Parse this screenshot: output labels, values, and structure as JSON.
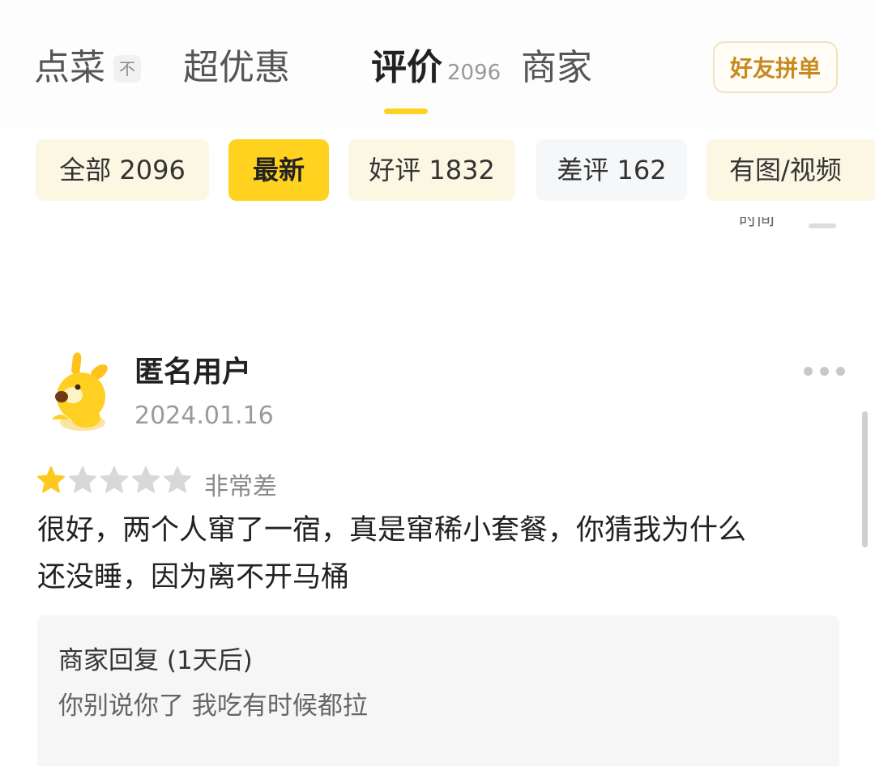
{
  "tabs": {
    "menu": {
      "label": "点菜",
      "badge": "不"
    },
    "deals": {
      "label": "超优惠"
    },
    "reviews": {
      "label": "评价",
      "count": "2096"
    },
    "merchant": {
      "label": "商家"
    },
    "active": "reviews"
  },
  "group_order_button": "好友拼单",
  "filters": [
    {
      "label": "全部 2096",
      "selected": false
    },
    {
      "label": "最新",
      "selected": true
    },
    {
      "label": "好评 1832",
      "selected": false
    },
    {
      "label": "差评 162",
      "selected": false
    },
    {
      "label": "有图/视频",
      "selected": false
    }
  ],
  "sort_label": "时间",
  "review": {
    "username": "匿名用户",
    "date": "2024.01.16",
    "rating": 1,
    "rating_max": 5,
    "rating_text": "非常差",
    "body_line1": "很好，两个人窜了一宿，真是窜稀小套餐，你猜我为什么",
    "body_line2": "还没睡，因为离不开马桶",
    "reply": {
      "title": "商家回复 (1天后)",
      "text": "你别说你了 我吃有时候都拉"
    }
  },
  "colors": {
    "accent": "#ffd21f",
    "star_filled": "#ffc81e",
    "star_empty": "#d8d8d8",
    "group_order_text": "#c88a1e"
  },
  "icons": {
    "avatar": "yellow-dog-mascot",
    "more": "more-dots-icon",
    "star": "star-icon"
  }
}
